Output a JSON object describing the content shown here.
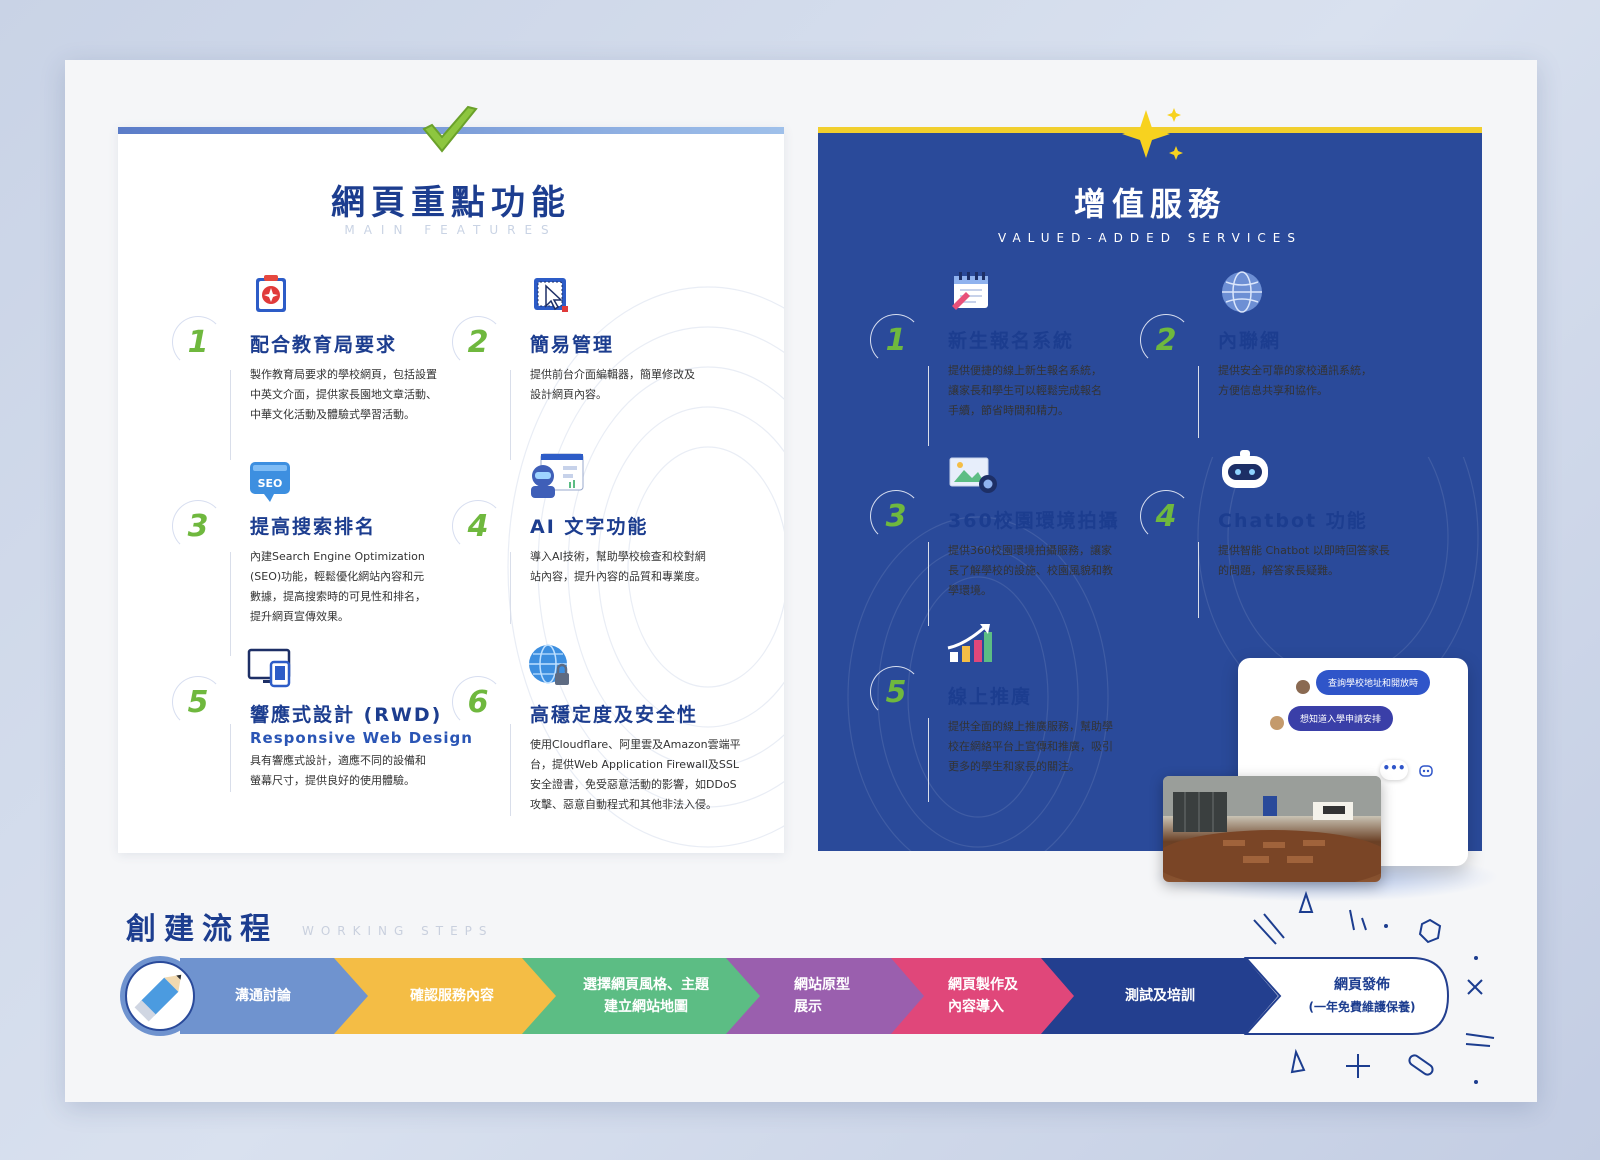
{
  "features": {
    "title": "網頁重點功能",
    "subtitle": "MAIN FEATURES",
    "items": [
      {
        "num": "1",
        "title": "配合教育局要求",
        "desc": [
          "製作教育局要求的學校網頁，包括設置",
          "中英文介面，提供家長園地文章活動、",
          "中華文化活動及體驗式學習活動。"
        ],
        "icon": "hong-kong-book-icon"
      },
      {
        "num": "2",
        "title": "簡易管理",
        "desc": [
          "提供前台介面編輯器，簡單修改及",
          "設計網頁內容。"
        ],
        "icon": "cursor-select-icon"
      },
      {
        "num": "3",
        "title": "提高搜索排名",
        "desc": [
          "內建Search Engine Optimization",
          "(SEO)功能，輕鬆優化網站內容和元",
          "數據，提高搜索時的可見性和排名，",
          "提升網頁宣傳效果。"
        ],
        "icon": "seo-badge-icon"
      },
      {
        "num": "4",
        "title": "AI 文字功能",
        "desc": [
          "導入AI技術，幫助學校檢查和校對網",
          "站內容，提升內容的品質和專業度。"
        ],
        "icon": "ai-robot-icon"
      },
      {
        "num": "5",
        "title": "響應式設計 (RWD)",
        "subtitle": "Responsive Web Design",
        "desc": [
          "具有響應式設計，適應不同的設備和",
          "螢幕尺寸，提供良好的使用體驗。"
        ],
        "icon": "devices-icon"
      },
      {
        "num": "6",
        "title": "高穩定度及安全性",
        "desc": [
          "使用Cloudflare、阿里雲及Amazon雲端平",
          "台，提供Web Application Firewall及SSL",
          "安全證書，免受惡意活動的影響，如DDoS",
          "攻擊、惡意自動程式和其他非法入侵。"
        ],
        "icon": "secure-globe-icon"
      }
    ]
  },
  "services": {
    "title": "增值服務",
    "subtitle": "VALUED-ADDED SERVICES",
    "items": [
      {
        "num": "1",
        "title": "新生報名系統",
        "desc": [
          "提供便捷的線上新生報名系統，",
          "讓家長和學生可以輕鬆完成報名",
          "手續，節省時間和精力。"
        ],
        "icon": "registration-calendar-icon"
      },
      {
        "num": "2",
        "title": "內聯網",
        "desc": [
          "提供安全可靠的家校通訊系統，",
          "方便信息共享和協作。"
        ],
        "icon": "globe-icon"
      },
      {
        "num": "3",
        "title": "360校園環境拍攝",
        "desc": [
          "提供360校園環境拍攝服務，讓家",
          "長了解學校的設施、校園風貌和教",
          "學環境。"
        ],
        "icon": "camera-photo-icon"
      },
      {
        "num": "4",
        "title": "Chatbot 功能",
        "desc": [
          "提供智能 Chatbot 以即時回答家長",
          "的問題，解答家長疑難。"
        ],
        "icon": "chatbot-icon"
      },
      {
        "num": "5",
        "title": "線上推廣",
        "desc": [
          "提供全面的線上推廣服務，幫助學",
          "校在網絡平台上宣傳和推廣，吸引",
          "更多的學生和家長的關注。"
        ],
        "icon": "growth-chart-icon"
      }
    ],
    "chat": {
      "bubble1": "查詢學校地址和開放時",
      "bubble2": "想知道入學申請安排",
      "dots": "•••"
    }
  },
  "steps": {
    "title": "創建流程",
    "subtitle": "WORKING STEPS",
    "items": [
      {
        "line1": "溝通討論",
        "line2": "",
        "color": "#6f93cf"
      },
      {
        "line1": "確認服務內容",
        "line2": "",
        "color": "#f4bd45"
      },
      {
        "line1": "選擇網頁風格、主題",
        "line2": "建立網站地圖",
        "color": "#5cbd84"
      },
      {
        "line1": "網站原型",
        "line2": "展示",
        "color": "#9a5fae"
      },
      {
        "line1": "網頁製作及",
        "line2": "內容導入",
        "color": "#e0477a"
      },
      {
        "line1": "測試及培訓",
        "line2": "",
        "color": "#233f8f"
      },
      {
        "line1": "網頁發佈",
        "line2": "(一年免費維護保養)",
        "color": "#ffffff"
      }
    ]
  }
}
